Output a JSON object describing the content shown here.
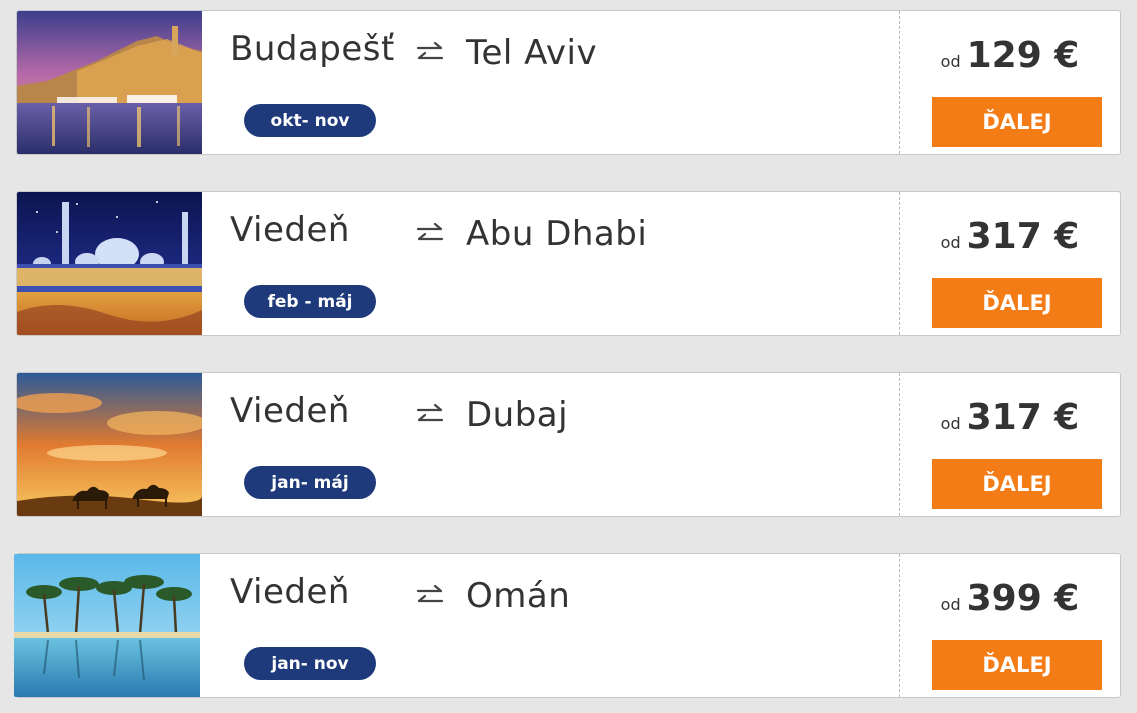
{
  "deals": [
    {
      "origin": "Budapešť",
      "destination": "Tel Aviv",
      "period": "okt- nov",
      "price_prefix": "od",
      "price": "129 €",
      "button_label": "ĎALEJ",
      "image": "tel-aviv-harbor-evening"
    },
    {
      "origin": "Viedeň",
      "destination": "Abu Dhabi",
      "period": "feb - máj",
      "price_prefix": "od",
      "price": "317 €",
      "button_label": "ĎALEJ",
      "image": "abu-dhabi-grand-mosque-night"
    },
    {
      "origin": "Viedeň",
      "destination": "Dubaj",
      "period": "jan- máj",
      "price_prefix": "od",
      "price": "317 €",
      "button_label": "ĎALEJ",
      "image": "desert-sunset-camels"
    },
    {
      "origin": "Viedeň",
      "destination": "Omán",
      "period": "jan- nov",
      "price_prefix": "od",
      "price": "399 €",
      "button_label": "ĎALEJ",
      "image": "palm-trees-beach-reflection"
    }
  ],
  "icons": {
    "route": "swap-arrows-icon"
  },
  "colors": {
    "accent_button": "#f47c16",
    "badge": "#1f3a7a",
    "background": "#e6e6e6"
  }
}
